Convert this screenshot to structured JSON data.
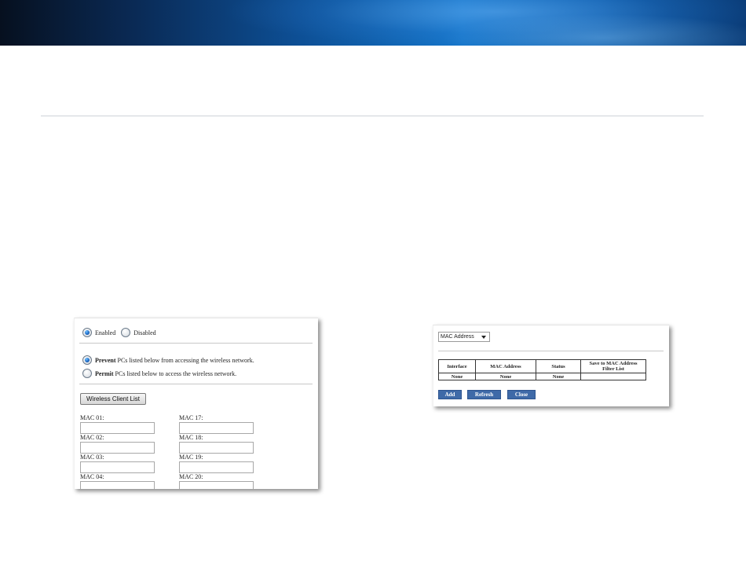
{
  "panel_filter": {
    "enabled_label": "Enabled",
    "disabled_label": "Disabled",
    "prevent_bold": "Prevent",
    "prevent_rest": " PCs listed below from accessing the wireless network.",
    "permit_bold": "Permit",
    "permit_rest": " PCs listed below to access the wireless network.",
    "client_list_button": "Wireless Client List",
    "mac_left": [
      "MAC 01:",
      "MAC 02:",
      "MAC 03:",
      "MAC 04:"
    ],
    "mac_right": [
      "MAC 17:",
      "MAC 18:",
      "MAC 19:",
      "MAC 20:"
    ]
  },
  "panel_clients": {
    "select_value": "MAC Address",
    "headers": [
      "Interface",
      "MAC Address",
      "Status",
      "Save to MAC Address Filter List"
    ],
    "row": [
      "None",
      "None",
      "None",
      ""
    ],
    "buttons": {
      "add": "Add",
      "refresh": "Refresh",
      "close": "Close"
    }
  },
  "colors": {
    "banner": "#0d4f95",
    "button_blue": "#3f6aa8",
    "radio_selected": "#1a66c2"
  }
}
